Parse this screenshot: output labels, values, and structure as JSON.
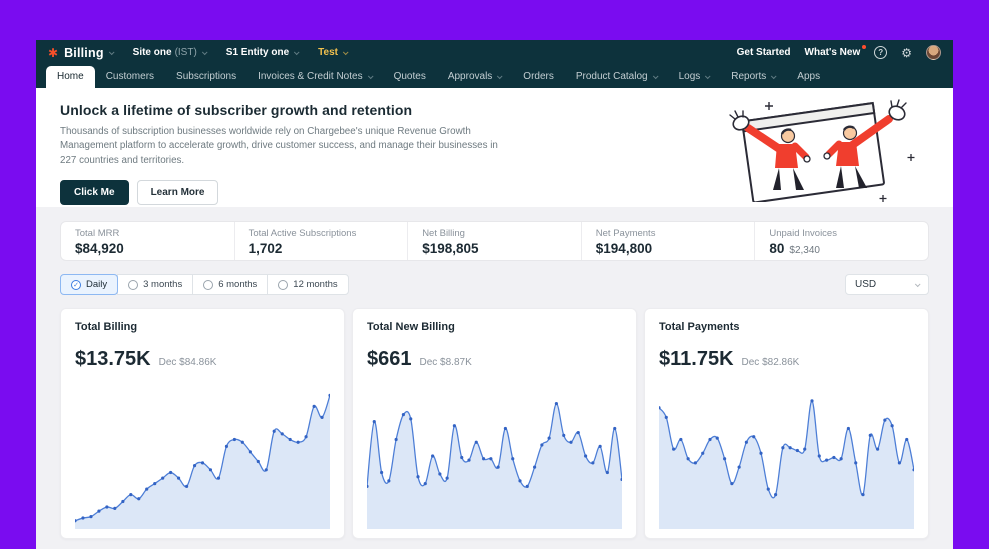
{
  "theme": {
    "frame_purple": "#7a0cf0",
    "navbar_dark": "#0d323c",
    "accent_blue": "#3b7ce0",
    "brand_orange": "#f4502a",
    "env_yellow": "#f2c14e",
    "alert_red": "#ff4d2e"
  },
  "icons": {
    "help_glyph": "?",
    "settings_glyph": "⚙",
    "brand_glyph": "✱"
  },
  "topbar": {
    "product": "Billing",
    "site": {
      "name": "Site one",
      "suffix": "(IST)"
    },
    "entity": "S1 Entity one",
    "env": "Test",
    "get_started": "Get Started",
    "whats_new": "What's New"
  },
  "nav": {
    "tabs": [
      {
        "label": "Home",
        "active": true
      },
      {
        "label": "Customers"
      },
      {
        "label": "Subscriptions"
      },
      {
        "label": "Invoices & Credit Notes",
        "caret": true
      },
      {
        "label": "Quotes"
      },
      {
        "label": "Approvals",
        "caret": true
      },
      {
        "label": "Orders"
      },
      {
        "label": "Product Catalog",
        "caret": true
      },
      {
        "label": "Logs",
        "caret": true
      },
      {
        "label": "Reports",
        "caret": true
      },
      {
        "label": "Apps"
      }
    ]
  },
  "hero": {
    "title": "Unlock a lifetime of subscriber growth and retention",
    "body": "Thousands of subscription businesses worldwide rely on Chargebee's unique Revenue Growth Management platform to accelerate growth, drive customer success, and manage their businesses in 227 countries and territories.",
    "primary_cta": "Click Me",
    "secondary_cta": "Learn More"
  },
  "stats": [
    {
      "label": "Total MRR",
      "value": "$84,920"
    },
    {
      "label": "Total Active Subscriptions",
      "value": "1,702"
    },
    {
      "label": "Net Billing",
      "value": "$198,805"
    },
    {
      "label": "Net Payments",
      "value": "$194,800"
    },
    {
      "label": "Unpaid Invoices",
      "value": "80",
      "sub": "$2,340"
    }
  ],
  "filters": {
    "options": [
      {
        "label": "Daily",
        "selected": true
      },
      {
        "label": "3 months"
      },
      {
        "label": "6 months"
      },
      {
        "label": "12 months"
      }
    ],
    "currency": "USD"
  },
  "chart_data": [
    {
      "type": "area",
      "title": "Total Billing",
      "value": "$13.75K",
      "subvalue": "Dec $84.86K",
      "ylim": [
        0,
        100
      ],
      "grid": false,
      "legend": false,
      "line_color": "#4d7ed6",
      "fill_color": "#dce7f7",
      "dot_color": "#3363c4",
      "values": [
        3,
        5,
        6,
        10,
        13,
        12,
        17,
        22,
        19,
        26,
        30,
        34,
        38,
        34,
        28,
        43,
        45,
        40,
        34,
        57,
        62,
        60,
        53,
        46,
        40,
        68,
        66,
        62,
        60,
        64,
        86,
        78,
        94
      ]
    },
    {
      "type": "area",
      "title": "Total New Billing",
      "value": "$661",
      "subvalue": "Dec $8.87K",
      "ylim": [
        0,
        100
      ],
      "grid": false,
      "legend": false,
      "line_color": "#4d7ed6",
      "fill_color": "#dce7f7",
      "dot_color": "#3363c4",
      "values": [
        28,
        75,
        38,
        32,
        62,
        80,
        77,
        35,
        30,
        50,
        37,
        34,
        72,
        49,
        47,
        60,
        48,
        48,
        42,
        70,
        48,
        32,
        28,
        42,
        58,
        63,
        88,
        65,
        60,
        67,
        50,
        45,
        57,
        38,
        70,
        33
      ]
    },
    {
      "type": "area",
      "title": "Total Payments",
      "value": "$11.75K",
      "subvalue": "Dec $82.86K",
      "ylim": [
        0,
        100
      ],
      "grid": false,
      "legend": false,
      "line_color": "#4d7ed6",
      "fill_color": "#dce7f7",
      "dot_color": "#3363c4",
      "values": [
        85,
        78,
        55,
        62,
        48,
        45,
        52,
        62,
        63,
        48,
        30,
        42,
        60,
        64,
        52,
        26,
        22,
        56,
        56,
        54,
        55,
        90,
        50,
        47,
        49,
        48,
        70,
        45,
        22,
        65,
        55,
        76,
        72,
        45,
        62,
        40
      ]
    }
  ]
}
